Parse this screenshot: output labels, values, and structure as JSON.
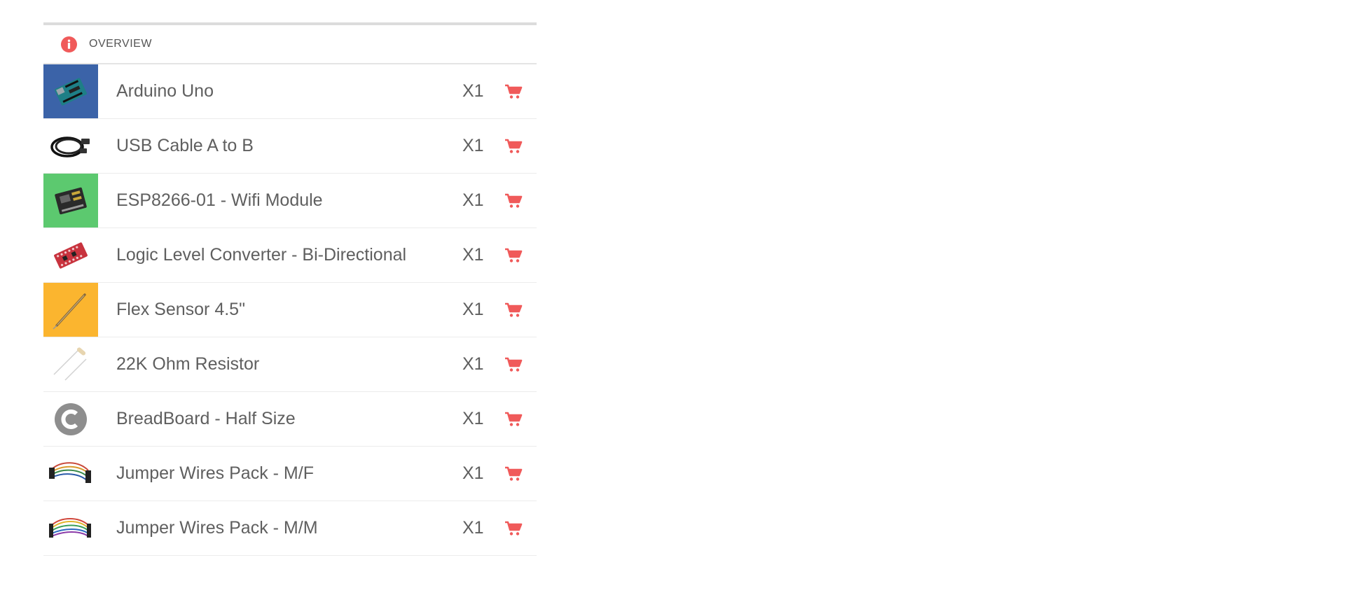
{
  "header": {
    "title": "OVERVIEW",
    "icon": "info-icon",
    "accent": "#f05a5a"
  },
  "items": [
    {
      "name": "Arduino Uno",
      "qty": "X1",
      "thumb": "arduino-uno-image",
      "thumb_bg": "#3b63a8"
    },
    {
      "name": "USB Cable A to B",
      "qty": "X1",
      "thumb": "usb-cable-image",
      "thumb_bg": "#ffffff"
    },
    {
      "name": "ESP8266-01 - Wifi Module",
      "qty": "X1",
      "thumb": "esp8266-module-image",
      "thumb_bg": "#5cc96f"
    },
    {
      "name": "Logic Level Converter - Bi-Directional",
      "qty": "X1",
      "thumb": "logic-level-converter-image",
      "thumb_bg": "#ffffff"
    },
    {
      "name": "Flex Sensor 4.5\"",
      "qty": "X1",
      "thumb": "flex-sensor-image",
      "thumb_bg": "#fbb52f"
    },
    {
      "name": "22K Ohm Resistor",
      "qty": "X1",
      "thumb": "resistor-image",
      "thumb_bg": "#ffffff"
    },
    {
      "name": "BreadBoard - Half Size",
      "qty": "X1",
      "thumb": "breadboard-image",
      "thumb_bg": "#ffffff"
    },
    {
      "name": "Jumper Wires Pack - M/F",
      "qty": "X1",
      "thumb": "jumper-wires-mf-image",
      "thumb_bg": "#ffffff"
    },
    {
      "name": "Jumper Wires Pack - M/M",
      "qty": "X1",
      "thumb": "jumper-wires-mm-image",
      "thumb_bg": "#ffffff"
    }
  ],
  "cart_icon": "shopping-cart-icon",
  "cart_color": "#f05a5a"
}
